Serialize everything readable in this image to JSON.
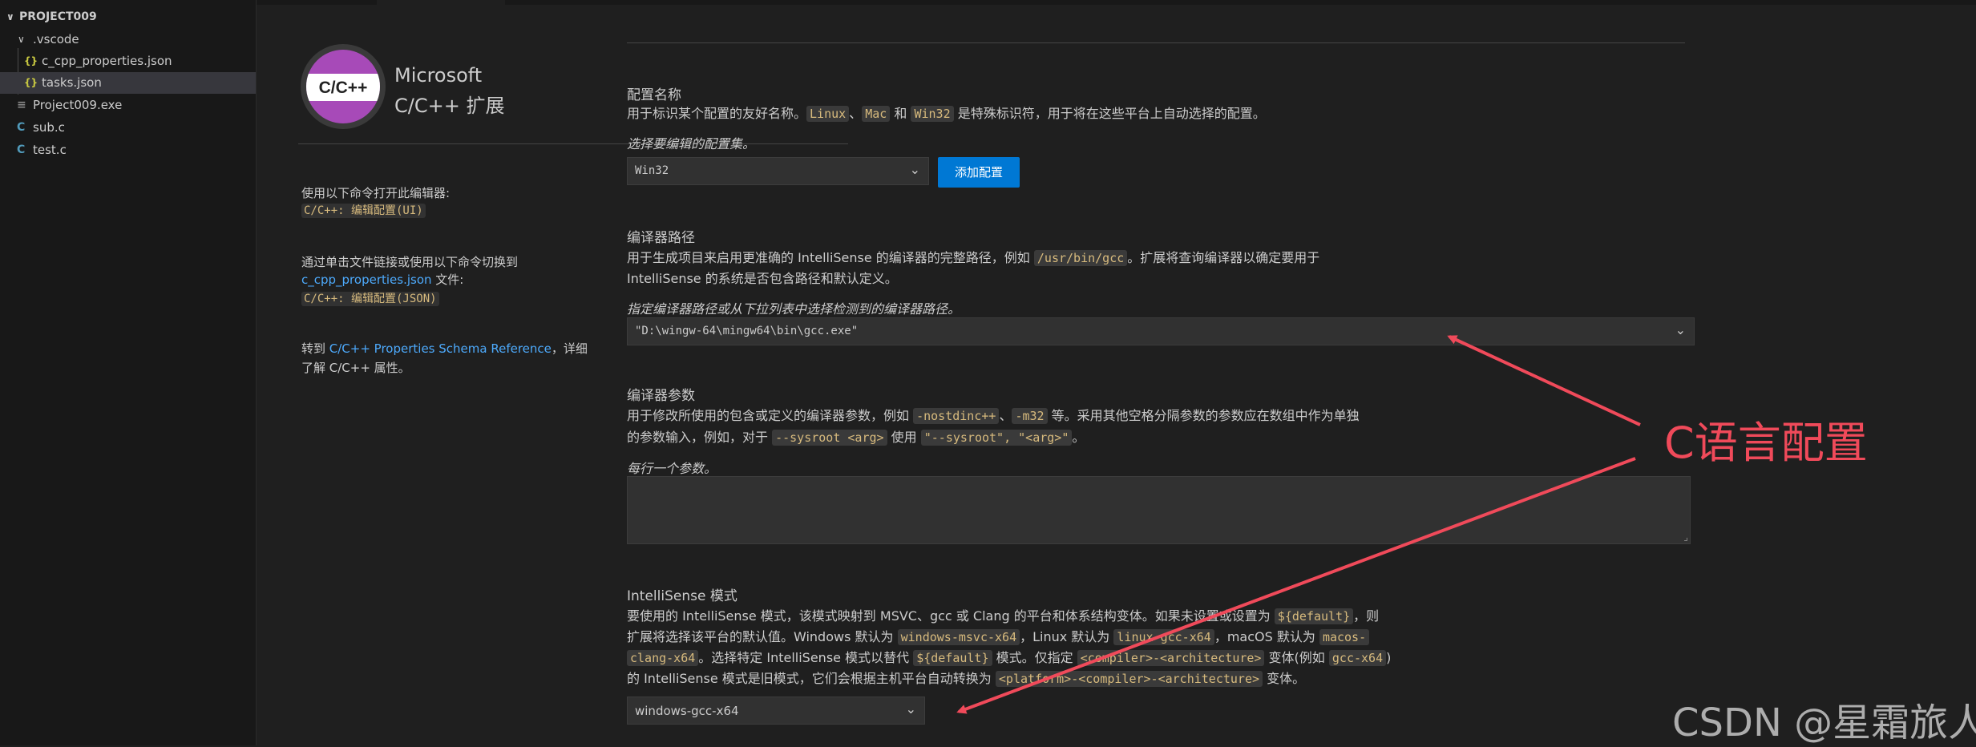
{
  "explorer": {
    "project": "PROJECT009",
    "items": [
      {
        "label": ".vscode",
        "icon": "chevron-down-icon"
      },
      {
        "label": "c_cpp_properties.json",
        "icon": "json-file-icon"
      },
      {
        "label": "tasks.json",
        "icon": "json-file-icon"
      },
      {
        "label": "Project009.exe",
        "icon": "exe-file-icon"
      },
      {
        "label": "sub.c",
        "icon": "c-file-icon"
      },
      {
        "label": "test.c",
        "icon": "c-file-icon"
      }
    ],
    "icon_glyphs": {
      "json": "{}",
      "c": "C",
      "exe": "≡",
      "chevron": "∨"
    }
  },
  "sidebar": {
    "logo_text": "C/C++",
    "brand_line1": "Microsoft",
    "brand_line2": "C/C++ 扩展",
    "open_text": "使用以下命令打开此编辑器:",
    "open_cmd": "C/C++: 编辑配置(UI)",
    "switch_text1": "通过单击文件链接或使用以下命令切换到",
    "switch_link": "c_cpp_properties.json",
    "switch_text2": " 文件:",
    "switch_cmd": "C/C++: 编辑配置(JSON)",
    "ref_prefix": "转到 ",
    "ref_link": "C/C++ Properties Schema Reference",
    "ref_suffix": "，详细",
    "ref_line2": "了解 C/C++ 属性。"
  },
  "config_name": {
    "title": "配置名称",
    "desc_a": "用于标识某个配置的友好名称。",
    "chip_linux": "Linux",
    "sep1": "、",
    "chip_mac": "Mac",
    "and": " 和 ",
    "chip_win32": "Win32",
    "desc_b": " 是特殊标识符，用于将在这些平台上自动选择的配置。",
    "hint": "选择要编辑的配置集。",
    "selected": "Win32",
    "add_button": "添加配置"
  },
  "compiler_path": {
    "title": "编译器路径",
    "line1_a": "用于生成项目来启用更准确的 IntelliSense 的编译器的完整路径，例如 ",
    "chip": "/usr/bin/gcc",
    "line1_b": "。扩展将查询编译器以确定要用于",
    "line2": "IntelliSense 的系统是否包含路径和默认定义。",
    "hint": "指定编译器路径或从下拉列表中选择检测到的编译器路径。",
    "value": "\"D:\\wingw-64\\mingw64\\bin\\gcc.exe\""
  },
  "compiler_args": {
    "title": "编译器参数",
    "line1_a": "用于修改所使用的包含或定义的编译器参数，例如 ",
    "chip1": "-nostdinc++",
    "sep": "、",
    "chip2": "-m32",
    "line1_b": " 等。采用其他空格分隔参数的参数应在数组中作为单独",
    "line2_a": "的参数输入，例如，对于 ",
    "chip3": "--sysroot <arg>",
    "line2_b": " 使用 ",
    "chip4": "\"--sysroot\", \"<arg>\"",
    "line2_c": "。",
    "hint": "每行一个参数。",
    "value": ""
  },
  "intellisense": {
    "title": "IntelliSense 模式",
    "l1_a": "要使用的 IntelliSense 模式，该模式映射到 MSVC、gcc 或 Clang 的平台和体系结构变体。如果未设置或设置为 ",
    "chip_default": "${default}",
    "l1_b": "，则",
    "l2_a": "扩展将选择该平台的默认值。Windows 默认为 ",
    "chip_win": "windows-msvc-x64",
    "l2_b": "，Linux 默认为 ",
    "chip_linux": "linux-gcc-x64",
    "l2_c": "，macOS 默认为 ",
    "chip_mac_a": "macos-",
    "chip_mac_b": "clang-x64",
    "l3_a": "。选择特定 IntelliSense 模式以替代 ",
    "chip_default2": "${default}",
    "l3_b": " 模式。仅指定 ",
    "chip_ca": "<compiler>-<architecture>",
    "l3_c": " 变体(例如 ",
    "chip_gcc": "gcc-x64",
    "l3_d": ")",
    "l4_a": "的 IntelliSense 模式是旧模式，它们会根据主机平台自动转换为 ",
    "chip_pca": "<platform>-<compiler>-<architecture>",
    "l4_b": " 变体。",
    "selected": "windows-gcc-x64"
  },
  "annotation": {
    "label": "C语言配置",
    "color": "#f04a5a"
  },
  "watermark": "CSDN @星霜旅人",
  "icons": {
    "chevron": "⌄",
    "resize": "⌟"
  }
}
